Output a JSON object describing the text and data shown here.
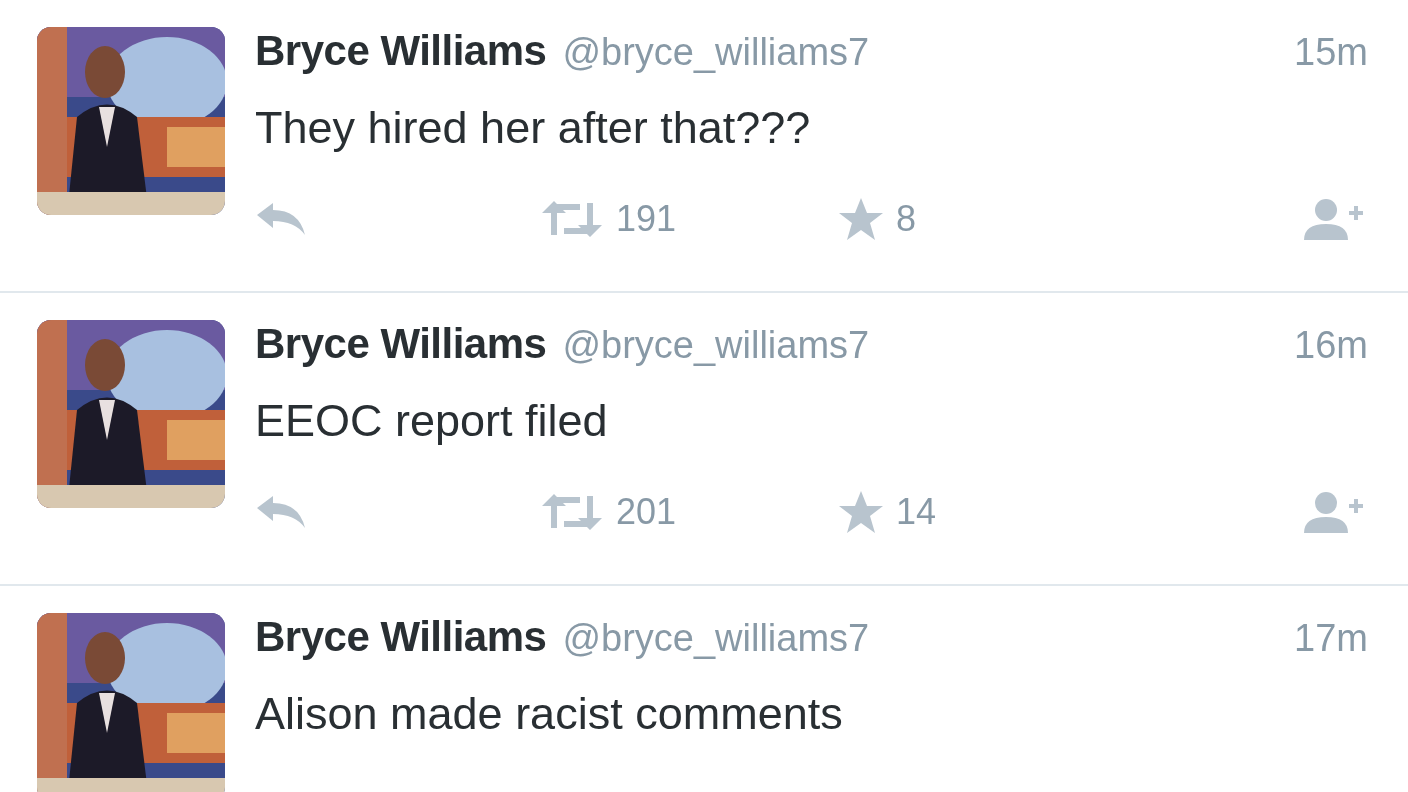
{
  "tweets": [
    {
      "name": "Bryce Williams",
      "handle": "@bryce_williams7",
      "time": "15m",
      "text": "They hired her after that???",
      "retweets": "191",
      "favorites": "8"
    },
    {
      "name": "Bryce Williams",
      "handle": "@bryce_williams7",
      "time": "16m",
      "text": "EEOC report filed",
      "retweets": "201",
      "favorites": "14"
    },
    {
      "name": "Bryce Williams",
      "handle": "@bryce_williams7",
      "time": "17m",
      "text": "Alison made racist comments"
    }
  ]
}
